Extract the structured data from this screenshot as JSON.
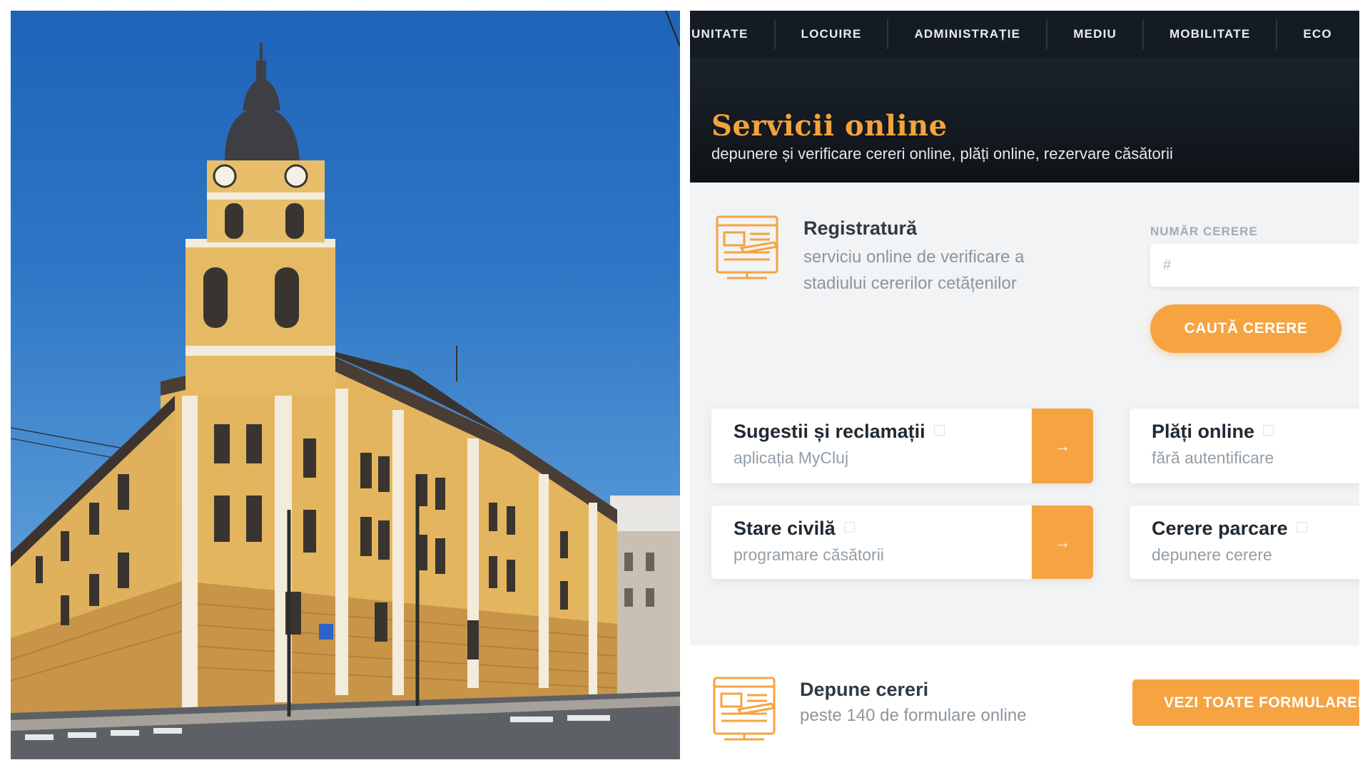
{
  "colors": {
    "accent": "#f6a342",
    "title_orange": "#f3a33b",
    "nav_bg": "#151b22",
    "panel_bg": "#f1f3f4"
  },
  "photo": {
    "subject": "Cluj-Napoca city hall building",
    "icon": "building-photo"
  },
  "nav": {
    "items": [
      {
        "label": "UNITATE"
      },
      {
        "label": "LOCUIRE"
      },
      {
        "label": "ADMINISTRAȚIE"
      },
      {
        "label": "MEDIU"
      },
      {
        "label": "MOBILITATE"
      },
      {
        "label": "ECO"
      }
    ]
  },
  "hero": {
    "title": "Servicii online",
    "subtitle": "depunere și verificare cereri online, plăți online, rezervare căsătorii"
  },
  "registratura": {
    "icon": "document-form-icon",
    "title": "Registratură",
    "description": "serviciu online de verificare a stadiului cererilor cetățenilor",
    "field_label": "NUMĂR CERERE",
    "field_placeholder": "#",
    "button_label": "CAUTĂ CERERE"
  },
  "cards": [
    {
      "title": "Sugestii și reclamații",
      "subtitle": "aplicația MyCluj",
      "arrow": "→"
    },
    {
      "title": "Plăți online",
      "subtitle": "fără autentificare"
    },
    {
      "title": "Stare civilă",
      "subtitle": "programare căsătorii",
      "arrow": "→"
    },
    {
      "title": "Cerere parcare",
      "subtitle": "depunere cerere"
    }
  ],
  "depune": {
    "icon": "document-form-icon",
    "title": "Depune cereri",
    "subtitle": "peste 140 de formulare online",
    "button_label": "VEZI TOATE FORMULARELE"
  }
}
